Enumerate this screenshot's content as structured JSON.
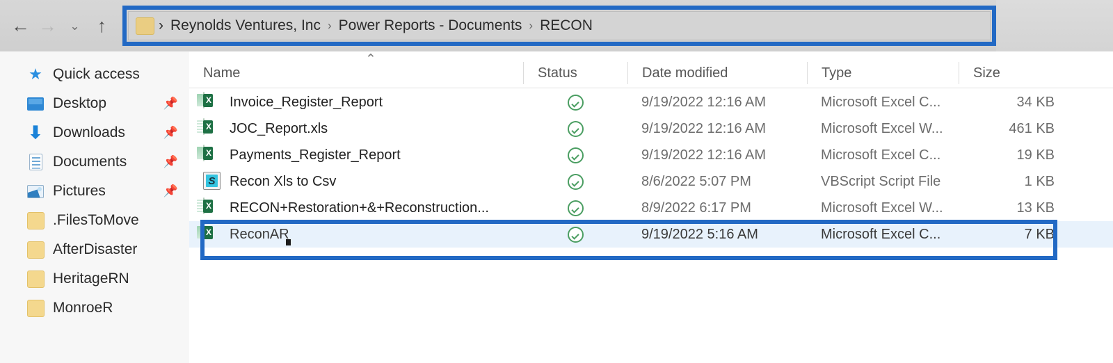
{
  "toolbar": {
    "back_icon": "arrow-left-icon",
    "forward_icon": "arrow-right-icon",
    "recent_icon": "chevron-down-icon",
    "up_icon": "arrow-up-icon",
    "back_label": "←",
    "forward_label": "→",
    "recent_label": "⌄",
    "up_label": "↑"
  },
  "address": {
    "folder_icon": "folder-icon",
    "separator": "›",
    "crumbs": [
      "Reynolds Ventures, Inc",
      "Power Reports - Documents",
      "RECON"
    ],
    "full_path": "Reynolds Ventures, Inc › Power Reports - Documents › RECON",
    "highlight_color": "#2269c4"
  },
  "sidebar": {
    "items": [
      {
        "label": "Quick access",
        "icon": "star-icon",
        "pinned": false
      },
      {
        "label": "Desktop",
        "icon": "desktop-icon",
        "pinned": true
      },
      {
        "label": "Downloads",
        "icon": "download-icon",
        "pinned": true
      },
      {
        "label": "Documents",
        "icon": "document-icon",
        "pinned": true
      },
      {
        "label": "Pictures",
        "icon": "pictures-icon",
        "pinned": true
      },
      {
        "label": ".FilesToMove",
        "icon": "folder-icon",
        "pinned": false
      },
      {
        "label": "AfterDisaster",
        "icon": "folder-icon",
        "pinned": false
      },
      {
        "label": "HeritageRN",
        "icon": "folder-icon",
        "pinned": false
      },
      {
        "label": "MonroeR",
        "icon": "folder-icon",
        "pinned": false
      }
    ],
    "pin_glyph": "📌"
  },
  "file_list": {
    "sort_indicator": "⌃",
    "sort_column": "Name",
    "sort_direction": "ascending",
    "columns": [
      "Name",
      "Status",
      "Date modified",
      "Type",
      "Size"
    ],
    "rows": [
      {
        "name": "Invoice_Register_Report",
        "icon": "excel-csv-icon",
        "status": "available-check-icon",
        "date_modified": "9/19/2022 12:16 AM",
        "type": "Microsoft Excel C...",
        "size": "34 KB",
        "selected": false
      },
      {
        "name": "JOC_Report.xls",
        "icon": "excel-worksheet-icon",
        "status": "available-check-icon",
        "date_modified": "9/19/2022 12:16 AM",
        "type": "Microsoft Excel W...",
        "size": "461 KB",
        "selected": false
      },
      {
        "name": "Payments_Register_Report",
        "icon": "excel-csv-icon",
        "status": "available-check-icon",
        "date_modified": "9/19/2022 12:16 AM",
        "type": "Microsoft Excel C...",
        "size": "19 KB",
        "selected": false
      },
      {
        "name": "Recon Xls to Csv",
        "icon": "vbscript-icon",
        "status": "available-check-icon",
        "date_modified": "8/6/2022 5:07 PM",
        "type": "VBScript Script File",
        "size": "1 KB",
        "selected": false
      },
      {
        "name": "RECON+Restoration+&+Reconstruction...",
        "icon": "excel-worksheet-icon",
        "status": "available-check-icon",
        "date_modified": "8/9/2022 6:17 PM",
        "type": "Microsoft Excel W...",
        "size": "13 KB",
        "selected": false
      },
      {
        "name": "ReconAR",
        "icon": "excel-csv-icon",
        "status": "available-check-icon",
        "date_modified": "9/19/2022 5:16 AM",
        "type": "Microsoft Excel C...",
        "size": "7 KB",
        "selected": true
      }
    ]
  },
  "annotations": {
    "color": "#2269c4",
    "targets": [
      "address-bar",
      "reconar-row"
    ]
  }
}
